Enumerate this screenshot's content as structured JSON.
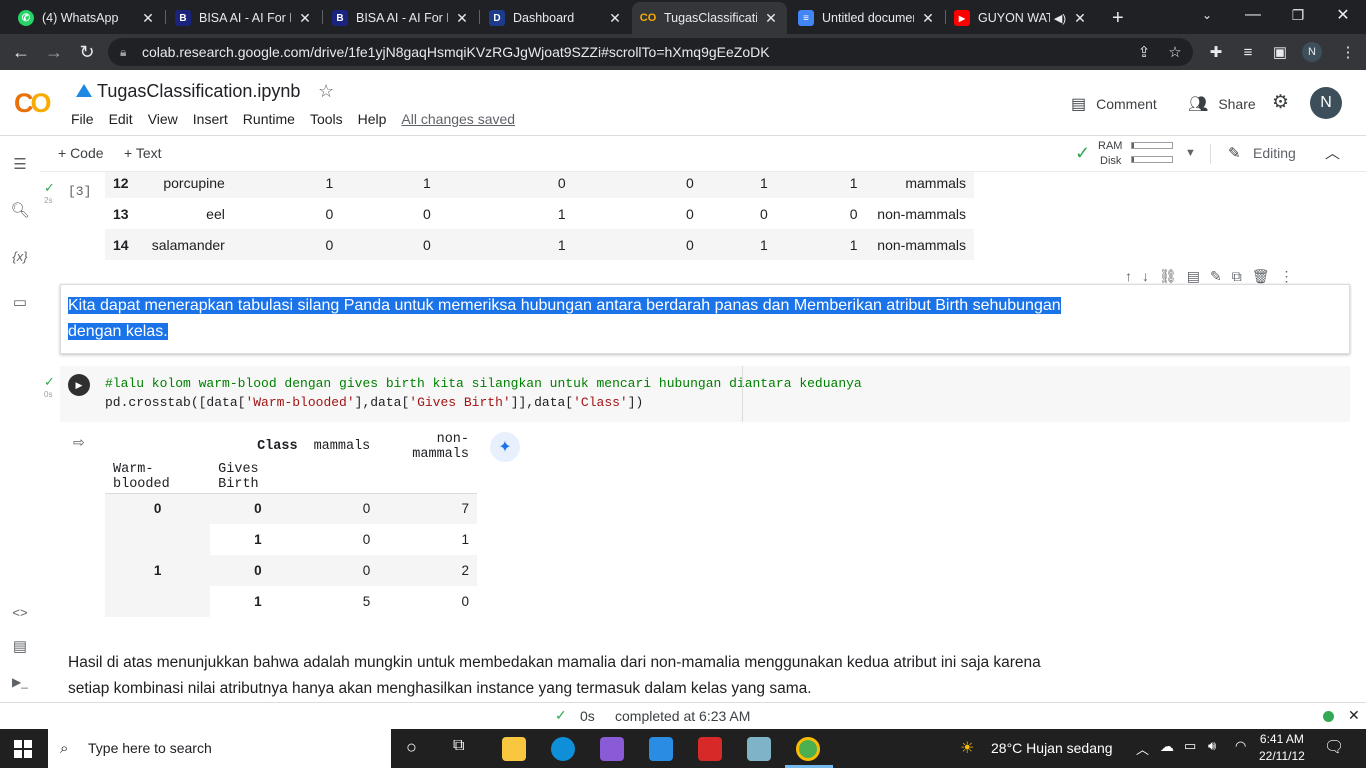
{
  "browser": {
    "tabs": [
      {
        "title": "(4) WhatsApp",
        "icon": "whatsapp-icon",
        "color": "#25d366"
      },
      {
        "title": "BISA AI - AI For Everyone",
        "icon": "bisa-ai-icon",
        "color": "#1a237e"
      },
      {
        "title": "BISA AI - AI For Everyone",
        "icon": "bisa-ai-icon",
        "color": "#1a237e"
      },
      {
        "title": "Dashboard",
        "icon": "dashboard-icon",
        "color": "#1e3a8a"
      },
      {
        "title": "TugasClassification.ipynb",
        "icon": "colab-icon",
        "color": "#f9ab00"
      },
      {
        "title": "Untitled document",
        "icon": "docs-icon",
        "color": "#4285f4"
      },
      {
        "title": "GUYON WATON",
        "icon": "youtube-icon",
        "color": "#ff0000"
      }
    ],
    "new_tab": "+",
    "url": "colab.research.google.com/drive/1fe1yjN8gaqHsmqiKVzRGJgWjoat9SZZi#scrollTo=hXmq9gEeZoDK",
    "profile_initial": "N"
  },
  "colab": {
    "logo": "CO",
    "notebook_title": "TugasClassification.ipynb",
    "menu": [
      "File",
      "Edit",
      "View",
      "Insert",
      "Runtime",
      "Tools",
      "Help"
    ],
    "saved_status": "All changes saved",
    "comment_label": "Comment",
    "share_label": "Share",
    "avatar": "N",
    "add_code": "+ Code",
    "add_text": "+ Text",
    "ram_label": "RAM",
    "disk_label": "Disk",
    "ram_fraction": 0.05,
    "disk_fraction": 0.05,
    "editing_label": "Editing"
  },
  "cell1": {
    "exec_count": "[3]",
    "exec_time": "2s",
    "rows": [
      [
        "12",
        "porcupine",
        "1",
        "1",
        "0",
        "0",
        "1",
        "1",
        "mammals"
      ],
      [
        "13",
        "eel",
        "0",
        "0",
        "1",
        "0",
        "0",
        "0",
        "non-mammals"
      ],
      [
        "14",
        "salamander",
        "0",
        "0",
        "1",
        "0",
        "1",
        "1",
        "non-mammals"
      ]
    ]
  },
  "text_cell": {
    "line1": "Kita dapat menerapkan tabulasi silang Panda untuk memeriksa hubungan antara berdarah panas dan Memberikan atribut Birth sehubungan",
    "line2": "dengan kelas."
  },
  "code_cell": {
    "exec_time": "0s",
    "comment": "#lalu kolom warm-blood dengan gives birth kita silangkan untuk mencari hubungan diantara keduanya",
    "code_pre": "pd.crosstab([data[",
    "str1": "'Warm-blooded'",
    "code_mid": "],data[",
    "str2": "'Gives Birth'",
    "code_mid2": "]],data[",
    "str3": "'Class'",
    "code_post": "])"
  },
  "crosstab": {
    "col_header_name": "Class",
    "columns": [
      "mammals",
      "non-mammals"
    ],
    "index_names": [
      "Warm-blooded",
      "Gives Birth"
    ],
    "rows": [
      {
        "wb": "0",
        "gb": "0",
        "mammals": "0",
        "non": "7"
      },
      {
        "wb": "",
        "gb": "1",
        "mammals": "0",
        "non": "1"
      },
      {
        "wb": "1",
        "gb": "0",
        "mammals": "0",
        "non": "2"
      },
      {
        "wb": "",
        "gb": "1",
        "mammals": "5",
        "non": "0"
      }
    ]
  },
  "text_cell2": {
    "line1": "Hasil di atas menunjukkan bahwa adalah mungkin untuk membedakan mamalia dari non-mamalia menggunakan kedua atribut ini saja karena",
    "line2": "setiap kombinasi nilai atributnya hanya akan menghasilkan instance yang termasuk dalam kelas yang sama."
  },
  "statusbar": {
    "time": "0s",
    "completed": "completed at 6:23 AM"
  },
  "taskbar": {
    "search_placeholder": "Type here to search",
    "weather": "28°C  Hujan sedang",
    "clock_time": "6:41 AM",
    "clock_date": "22/11/12"
  }
}
